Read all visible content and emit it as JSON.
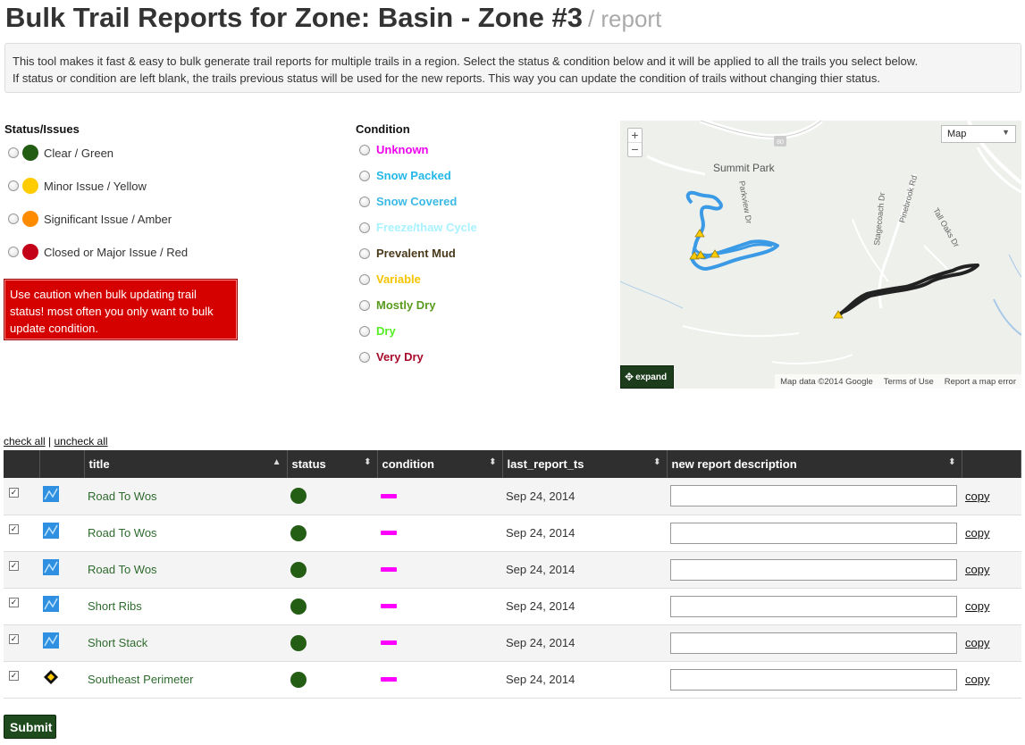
{
  "header": {
    "title": "Bulk Trail Reports for Zone: Basin - Zone #3",
    "subtitle": "/ report"
  },
  "intro": {
    "line1": "This tool makes it fast & easy to bulk generate trail reports for multiple trails in a region. Select the status & condition below and it will be applied to all the trails you select below.",
    "line2": "If status or condition are left blank, the trails previous status will be used for the new reports. This way you can update the condition of trails without changing thier status."
  },
  "status": {
    "label": "Status/Issues",
    "options": [
      {
        "label": "Clear / Green",
        "color": "#235c13"
      },
      {
        "label": "Minor Issue / Yellow",
        "color": "#ffcc00"
      },
      {
        "label": "Significant Issue / Amber",
        "color": "#ff8c00"
      },
      {
        "label": "Closed or Major Issue / Red",
        "color": "#c40018"
      }
    ],
    "warning": "Use caution when bulk updating trail status! most often you only want to bulk update condition."
  },
  "condition": {
    "label": "Condition",
    "options": [
      {
        "label": "Unknown",
        "color": "#ee00ee"
      },
      {
        "label": "Snow Packed",
        "color": "#23b8e8"
      },
      {
        "label": "Snow Covered",
        "color": "#3ab9e6"
      },
      {
        "label": "Freeze/thaw Cycle",
        "color": "#a8f2ff"
      },
      {
        "label": "Prevalent Mud",
        "color": "#4a3a1c"
      },
      {
        "label": "Variable",
        "color": "#f5c400"
      },
      {
        "label": "Mostly Dry",
        "color": "#5a9b1e"
      },
      {
        "label": "Dry",
        "color": "#55ee22"
      },
      {
        "label": "Very Dry",
        "color": "#a80a2a"
      }
    ]
  },
  "map": {
    "type_label": "Map",
    "expand_label": "expand",
    "place": "Summit Park",
    "highway": "80",
    "roads": [
      "Parkview Dr",
      "Stagecoach Dr",
      "Pinebrook Rd",
      "Tall Oaks Dr"
    ],
    "footer": [
      "Map data ©2014 Google",
      "Terms of Use",
      "Report a map error"
    ]
  },
  "checks": {
    "check_all": "check all",
    "separator": "|",
    "uncheck_all": "uncheck all"
  },
  "table": {
    "columns": [
      "title",
      "status",
      "condition",
      "last_report_ts",
      "new report description"
    ],
    "rows": [
      {
        "title": "Road To Wos",
        "icon": "route-icon",
        "date": "Sep 24, 2014"
      },
      {
        "title": "Road To Wos",
        "icon": "route-icon",
        "date": "Sep 24, 2014"
      },
      {
        "title": "Road To Wos",
        "icon": "route-icon",
        "date": "Sep 24, 2014"
      },
      {
        "title": "Short Ribs",
        "icon": "route-icon",
        "date": "Sep 24, 2014"
      },
      {
        "title": "Short Stack",
        "icon": "route-icon",
        "date": "Sep 24, 2014"
      },
      {
        "title": "Southeast Perimeter",
        "icon": "diamond-trail-icon",
        "date": "Sep 24, 2014"
      }
    ],
    "copy_label": "copy"
  },
  "submit_label": "Submit"
}
